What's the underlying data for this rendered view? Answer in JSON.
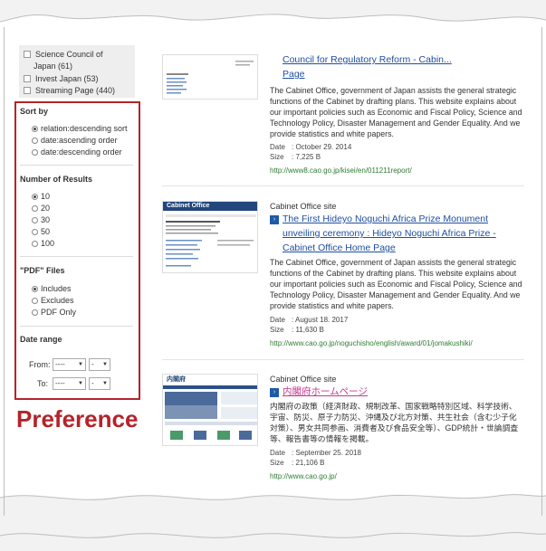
{
  "filters": {
    "items": [
      {
        "label_line1": "Science Council of",
        "label_line2": "Japan (61)"
      },
      {
        "label": "Invest Japan (53)"
      },
      {
        "label": "Streaming Page (440)"
      }
    ]
  },
  "sort_by": {
    "title": "Sort by",
    "options": [
      "relation:descending sort",
      "date:ascending order",
      "date:descending order"
    ],
    "selected": 0
  },
  "num_results": {
    "title": "Number of Results",
    "options": [
      "10",
      "20",
      "30",
      "50",
      "100"
    ],
    "selected": 0
  },
  "pdf_files": {
    "title": "\"PDF\" Files",
    "options": [
      "Includes",
      "Excludes",
      "PDF Only"
    ],
    "selected": 0
  },
  "date_range": {
    "title": "Date range",
    "from_label": "From:",
    "to_label": "To:",
    "year_placeholder": "----",
    "month_placeholder": "-"
  },
  "preference_label": "Preference",
  "results": [
    {
      "title_line1": "Council for Regulatory Reform - Cabin...",
      "title_line2": "Page",
      "description": "The Cabinet Office, government of Japan assists the general strategic functions of the Cabinet by drafting plans. This website explains about our important policies such as Economic and Fiscal Policy, Science and Technology Policy, Disaster Management and Gender Equality. And we provide statistics and white papers.",
      "date_label": "Date",
      "date": ": October 29. 2014",
      "size_label": "Size",
      "size": ": 7,225 B",
      "url": "http://www8.cao.go.jp/kisei/en/011211report/"
    },
    {
      "site": "Cabinet Office site",
      "title": "The First Hideyo Noguchi Africa Prize Monument unveiling ceremony : Hideyo Noguchi Africa Prize - Cabinet Office Home Page",
      "description": "The Cabinet Office, government of Japan assists the general strategic functions of the Cabinet by drafting plans. This website explains about our important policies such as Economic and Fiscal Policy, Science and Technology Policy, Disaster Management and Gender Equality. And we provide statistics and white papers.",
      "date_label": "Date",
      "date": ": August 18. 2017",
      "size_label": "Size",
      "size": ": 11,630 B",
      "url": "http://www.cao.go.jp/noguchisho/english/award/01/jomakushiki/",
      "thumb_header": "Cabinet Office"
    },
    {
      "site": "Cabinet Office site",
      "title": "内閣府ホームページ",
      "description": "内閣府の政策（経済財政、規制改革、国家戦略特別区域、科学技術、宇宙、防災、原子力防災、沖縄及び北方対策、共生社会（含む少子化対策）、男女共同参画、消費者及び食品安全等）、GDP統計・世論調査等、報告書等の情報を掲載。",
      "date_label": "Date",
      "date": ": September 25. 2018",
      "size_label": "Size",
      "size": ": 21,106 B",
      "url": "http://www.cao.go.jp/",
      "thumb_header": "内閣府"
    }
  ]
}
